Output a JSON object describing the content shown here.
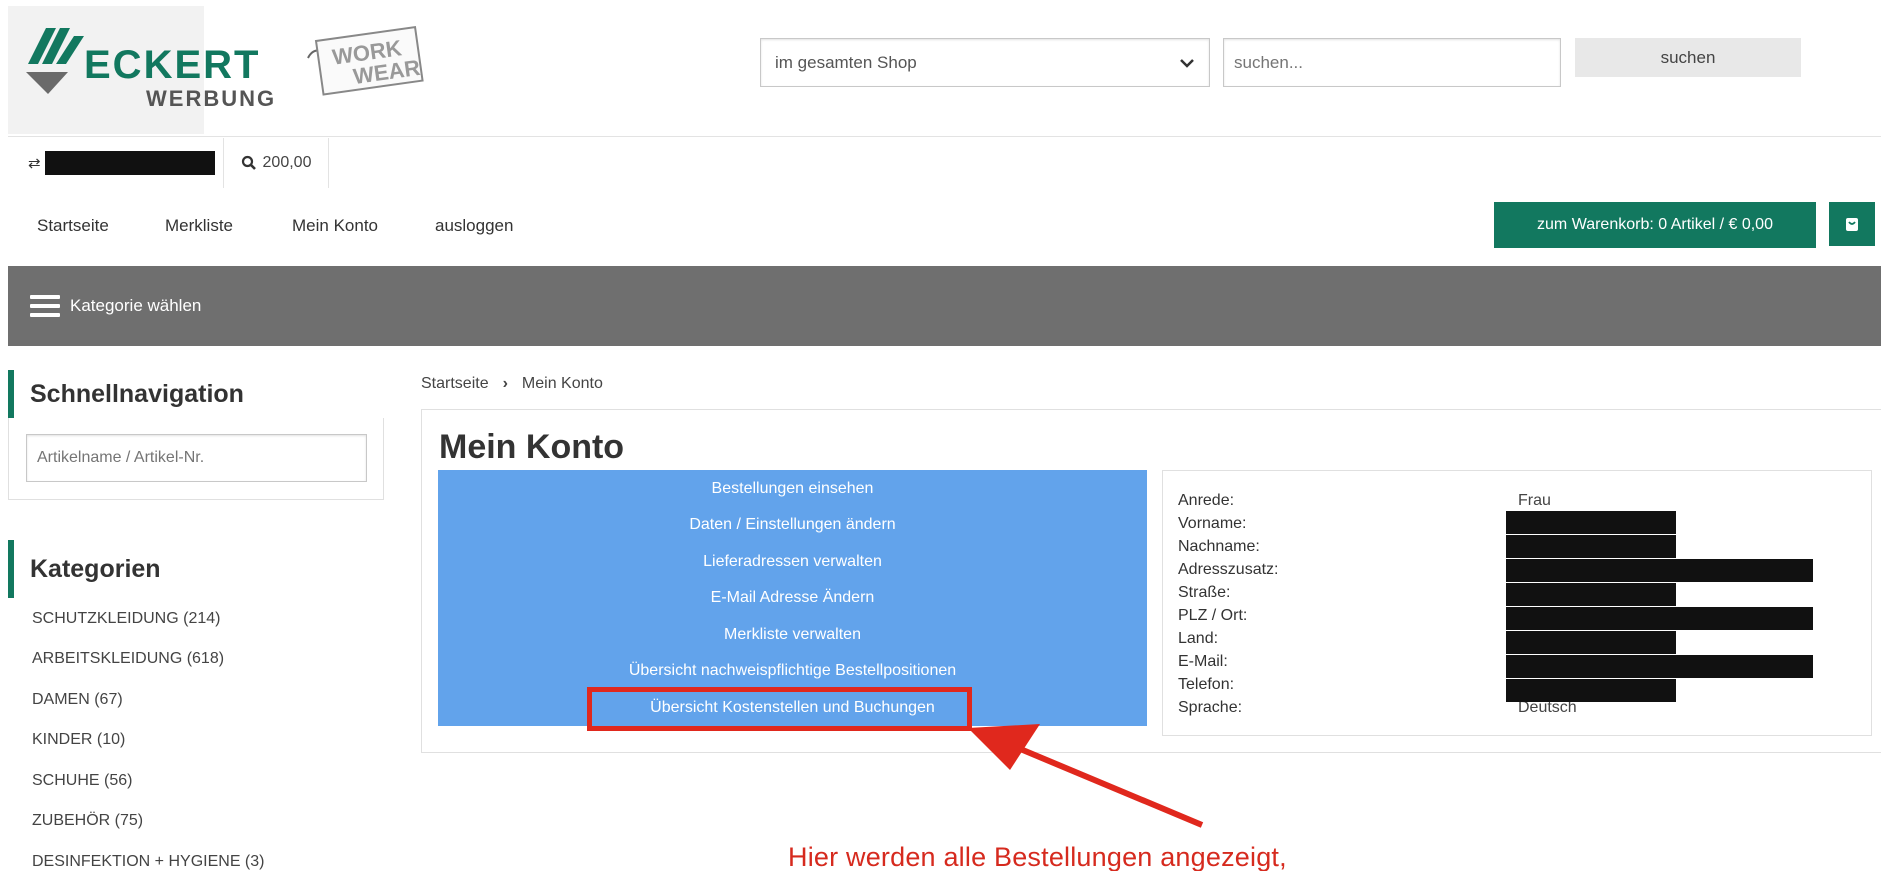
{
  "header": {
    "logo": {
      "brand": "ECKERT",
      "sub": "WERBUNG",
      "tag_line1": "WORK",
      "tag_line2": "WEAR"
    },
    "search": {
      "scope_selected": "im gesamten Shop",
      "placeholder": "suchen...",
      "button_label": "suchen"
    }
  },
  "account_bar": {
    "swap_glyph": "⇄",
    "budget": "200,00"
  },
  "nav": {
    "items": [
      "Startseite",
      "Merkliste",
      "Mein Konto",
      "ausloggen"
    ],
    "cart_label": "zum Warenkorb: 0 Artikel / € 0,00"
  },
  "category_bar": {
    "label": "Kategorie wählen"
  },
  "sidebar": {
    "quicknav_title": "Schnellnavigation",
    "quicknav_placeholder": "Artikelname / Artikel-Nr.",
    "categories_title": "Kategorien",
    "categories": [
      "SCHUTZKLEIDUNG (214)",
      "ARBEITSKLEIDUNG (618)",
      "DAMEN (67)",
      "KINDER (10)",
      "SCHUHE (56)",
      "ZUBEHÖR (75)",
      "DESINFEKTION + HYGIENE (3)"
    ]
  },
  "breadcrumb": {
    "home": "Startseite",
    "separator": "›",
    "current": "Mein Konto"
  },
  "main": {
    "title": "Mein Konto",
    "menu": [
      "Bestellungen einsehen",
      "Daten / Einstellungen ändern",
      "Lieferadressen verwalten",
      "E-Mail Adresse Ändern",
      "Merkliste verwalten",
      "Übersicht nachweispflichtige Bestellpositionen",
      "Übersicht Kostenstellen und Buchungen"
    ],
    "info_labels": [
      "Anrede:",
      "Vorname:",
      "Nachname:",
      "Adresszusatz:",
      "Straße:",
      "PLZ / Ort:",
      "Land:",
      "E-Mail:",
      "Telefon:",
      "Sprache:"
    ],
    "info_values": {
      "anrede": "Frau",
      "sprache": "Deutsch"
    }
  },
  "annotation": {
    "text": "Hier werden alle Bestellungen angezeigt,"
  },
  "colors": {
    "green": "#12785f",
    "blue_panel": "#62a3eb",
    "grey_bar": "#6f6f6f",
    "annotation_red": "#e0281d"
  }
}
